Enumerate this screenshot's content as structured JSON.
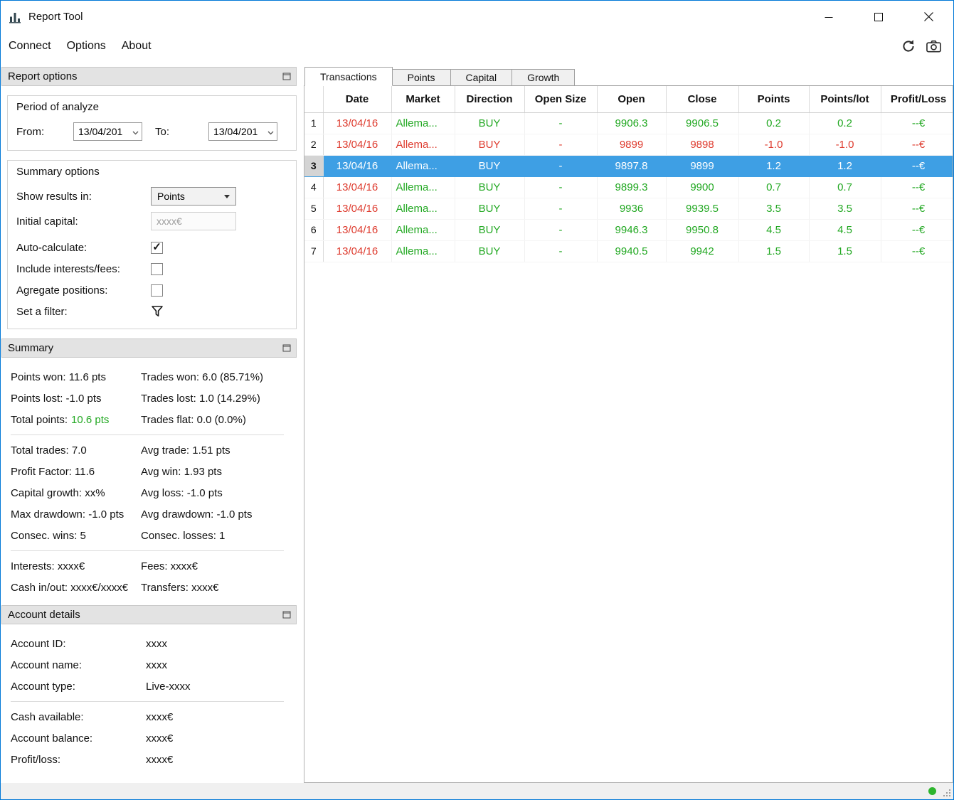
{
  "colors": {
    "window_border": "#0078d7",
    "selection_blue": "#3e9fe4",
    "win_green": "#22a822",
    "loss_red": "#de3b2e",
    "status_green": "#2db52d"
  },
  "titlebar": {
    "title": "Report Tool"
  },
  "menubar": {
    "items": [
      "Connect",
      "Options",
      "About"
    ]
  },
  "report_options": {
    "header": "Report options",
    "period": {
      "title": "Period of analyze",
      "from_label": "From:",
      "from_value": "13/04/201",
      "to_label": "To:",
      "to_value": "13/04/201"
    },
    "options": {
      "title": "Summary options",
      "show_results_label": "Show results in:",
      "show_results_value": "Points",
      "initial_capital_label": "Initial capital:",
      "initial_capital_value": "xxxx€",
      "auto_calculate_label": "Auto-calculate:",
      "include_interests_label": "Include interests/fees:",
      "aggregate_label": "Agregate positions:",
      "filter_label": "Set a filter:"
    }
  },
  "summary": {
    "header": "Summary",
    "group1": [
      {
        "left": "Points won: 11.6 pts",
        "right": "Trades won: 6.0 (85.71%)"
      },
      {
        "left": "Points lost: -1.0 pts",
        "right": "Trades lost: 1.0 (14.29%)"
      }
    ],
    "total_points_label": "Total points:",
    "total_points_value": "10.6 pts",
    "total_points_right": "Trades flat: 0.0 (0.0%)",
    "group2": [
      {
        "left": "Total trades: 7.0",
        "right": "Avg trade: 1.51 pts"
      },
      {
        "left": "Profit Factor: 11.6",
        "right": "Avg win: 1.93 pts"
      },
      {
        "left": "Capital growth: xx%",
        "right": "Avg loss: -1.0 pts"
      },
      {
        "left": "Max drawdown: -1.0 pts",
        "right": "Avg drawdown: -1.0 pts"
      },
      {
        "left": "Consec. wins: 5",
        "right": "Consec. losses: 1"
      }
    ],
    "group3": [
      {
        "left": "Interests: xxxx€",
        "right": "Fees: xxxx€"
      },
      {
        "left": "Cash in/out: xxxx€/xxxx€",
        "right": "Transfers: xxxx€"
      }
    ]
  },
  "account": {
    "header": "Account details",
    "group1": [
      {
        "label": "Account ID:",
        "value": "xxxx"
      },
      {
        "label": "Account name:",
        "value": "xxxx"
      },
      {
        "label": "Account type:",
        "value": "Live-xxxx"
      }
    ],
    "group2": [
      {
        "label": "Cash available:",
        "value": "xxxx€"
      },
      {
        "label": "Account balance:",
        "value": "xxxx€"
      },
      {
        "label": "Profit/loss:",
        "value": "xxxx€"
      }
    ]
  },
  "tabs": [
    "Transactions",
    "Points",
    "Capital",
    "Growth"
  ],
  "table": {
    "headers": [
      "Date",
      "Market",
      "Direction",
      "Open Size",
      "Open",
      "Close",
      "Points",
      "Points/lot",
      "Profit/Loss"
    ],
    "rows": [
      {
        "num": "1",
        "date": "13/04/16",
        "market": "Allema...",
        "direction": "BUY",
        "open_size": "-",
        "open": "9906.3",
        "close": "9906.5",
        "points": "0.2",
        "points_lot": "0.2",
        "profit_loss": "--€",
        "state": "win"
      },
      {
        "num": "2",
        "date": "13/04/16",
        "market": "Allema...",
        "direction": "BUY",
        "open_size": "-",
        "open": "9899",
        "close": "9898",
        "points": "-1.0",
        "points_lot": "-1.0",
        "profit_loss": "--€",
        "state": "loss"
      },
      {
        "num": "3",
        "date": "13/04/16",
        "market": "Allema...",
        "direction": "BUY",
        "open_size": "-",
        "open": "9897.8",
        "close": "9899",
        "points": "1.2",
        "points_lot": "1.2",
        "profit_loss": "--€",
        "state": "selected"
      },
      {
        "num": "4",
        "date": "13/04/16",
        "market": "Allema...",
        "direction": "BUY",
        "open_size": "-",
        "open": "9899.3",
        "close": "9900",
        "points": "0.7",
        "points_lot": "0.7",
        "profit_loss": "--€",
        "state": "win"
      },
      {
        "num": "5",
        "date": "13/04/16",
        "market": "Allema...",
        "direction": "BUY",
        "open_size": "-",
        "open": "9936",
        "close": "9939.5",
        "points": "3.5",
        "points_lot": "3.5",
        "profit_loss": "--€",
        "state": "win"
      },
      {
        "num": "6",
        "date": "13/04/16",
        "market": "Allema...",
        "direction": "BUY",
        "open_size": "-",
        "open": "9946.3",
        "close": "9950.8",
        "points": "4.5",
        "points_lot": "4.5",
        "profit_loss": "--€",
        "state": "win"
      },
      {
        "num": "7",
        "date": "13/04/16",
        "market": "Allema...",
        "direction": "BUY",
        "open_size": "-",
        "open": "9940.5",
        "close": "9942",
        "points": "1.5",
        "points_lot": "1.5",
        "profit_loss": "--€",
        "state": "win"
      }
    ]
  }
}
